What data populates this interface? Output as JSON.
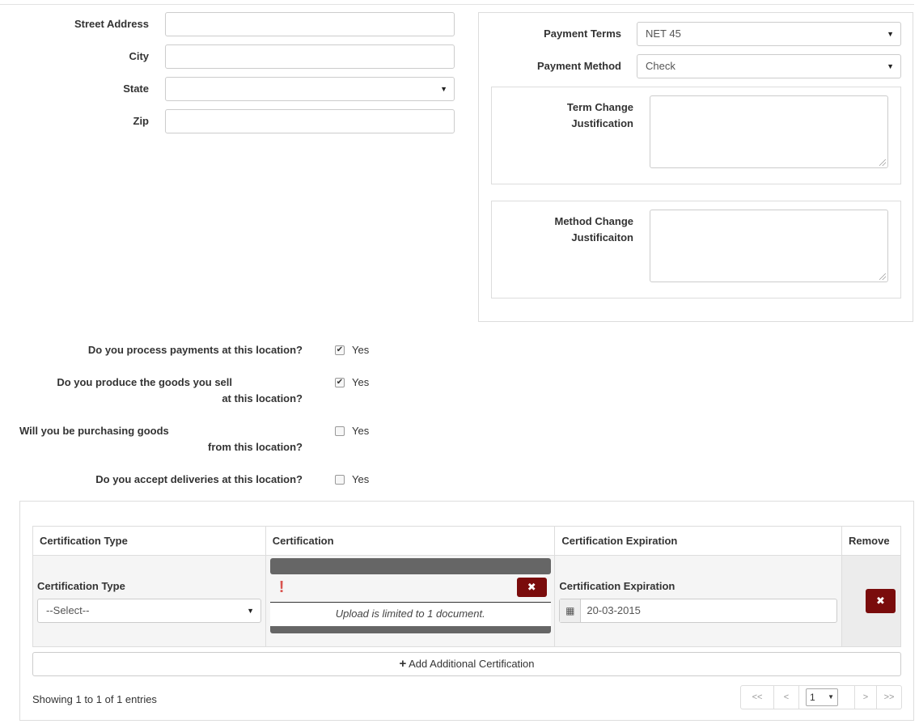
{
  "address": {
    "street_label": "Street Address",
    "city_label": "City",
    "state_label": "State",
    "zip_label": "Zip",
    "street_value": "",
    "city_value": "",
    "state_value": "",
    "zip_value": ""
  },
  "payment": {
    "terms_label": "Payment Terms",
    "terms_value": "NET 45",
    "method_label": "Payment Method",
    "method_value": "Check",
    "term_change_label_1": "Term Change",
    "term_change_label_2": "Justification",
    "method_change_label_1": "Method Change",
    "method_change_label_2": "Justificaiton"
  },
  "questions": [
    {
      "line1": "Do you process payments at this location?",
      "line2": "",
      "checked": true,
      "option": "Yes"
    },
    {
      "line1": "Do you produce the goods you sell",
      "line2": "at this location?",
      "checked": true,
      "option": "Yes"
    },
    {
      "line1": "Will you be purchasing goods",
      "line2": "from this location?",
      "checked": false,
      "option": "Yes"
    },
    {
      "line1": "Do you accept deliveries at this location?",
      "line2": "",
      "checked": false,
      "option": "Yes"
    }
  ],
  "certifications": {
    "headers": [
      "Certification Type",
      "Certification",
      "Certification Expiration",
      "Remove"
    ],
    "row": {
      "type_label": "Certification Type",
      "type_value": "--Select--",
      "upload_message": "Upload is limited to 1 document.",
      "expiration_label": "Certification Expiration",
      "expiration_value": "20-03-2015"
    },
    "add_button_label": "Add Additional Certification",
    "showing_text": "Showing 1 to 1 of 1 entries",
    "pager": {
      "first": "<<",
      "prev": "<",
      "page": "1",
      "next": ">",
      "last": ">>"
    }
  },
  "colors": {
    "danger": "#7a0c0c",
    "warning_icon": "#d9534f",
    "upload_bar": "#666666"
  }
}
